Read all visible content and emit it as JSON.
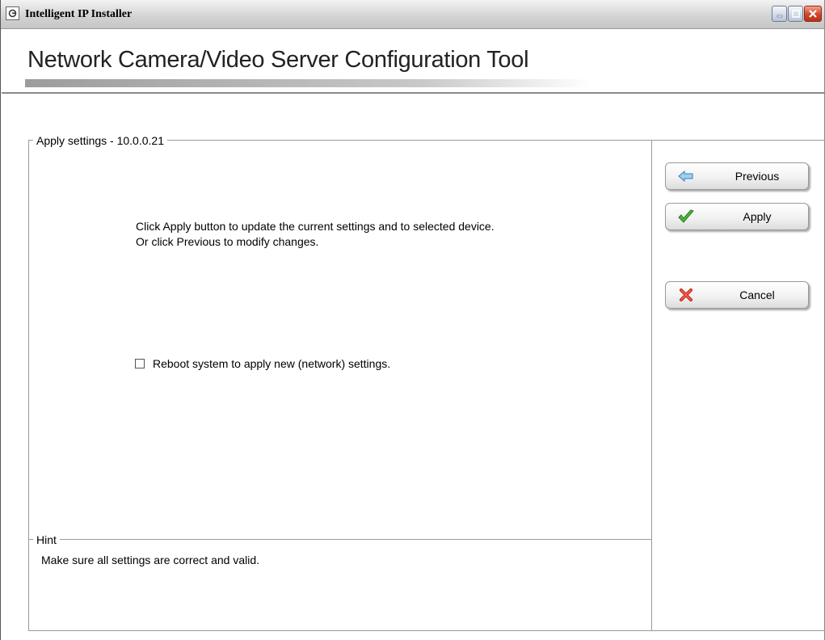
{
  "window": {
    "title": "Intelligent IP Installer",
    "controls": [
      "minimize",
      "maximize",
      "close"
    ]
  },
  "header": {
    "title": "Network Camera/Video Server Configuration Tool"
  },
  "settings": {
    "legend": "Apply settings - 10.0.0.21",
    "instructions": "Click Apply button to update the current settings and to selected device. Or click Previous to modify changes.",
    "reboot_checkbox": {
      "label": "Reboot system to apply  new (network) settings.",
      "checked": false
    }
  },
  "hint": {
    "legend": "Hint",
    "text": "Make sure all settings are correct and valid."
  },
  "actions": {
    "previous": {
      "label": "Previous",
      "icon": "arrow-left-icon"
    },
    "apply": {
      "label": "Apply",
      "icon": "checkmark-icon"
    },
    "cancel": {
      "label": "Cancel",
      "icon": "x-icon"
    }
  },
  "colors": {
    "title_bar": "#d2d2d2",
    "close_button": "#d0452a",
    "checkmark": "#3aa82a",
    "cancel_x": "#c0261a",
    "arrow": "#5aa6dc"
  }
}
